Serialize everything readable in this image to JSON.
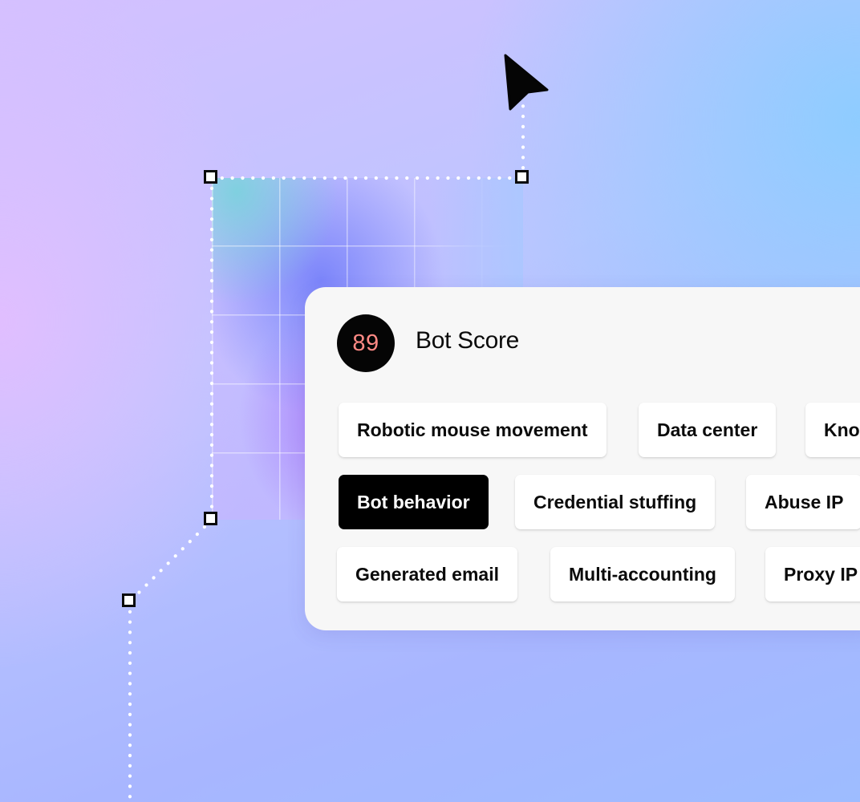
{
  "bot_score": {
    "score": "89",
    "title": "Bot Score",
    "score_color": "#ff8a85"
  },
  "signals": {
    "row1": [
      "Robotic mouse movement",
      "Data center",
      "Kno"
    ],
    "row2": [
      "Bot behavior",
      "Credential stuffing",
      "Abuse IP"
    ],
    "row3": [
      "Generated email",
      "Multi-accounting",
      "Proxy IP"
    ],
    "active": "Bot behavior"
  },
  "icons": {
    "pointer": "cursor-arrow-icon",
    "handles": "selection-handle-icon"
  },
  "colors": {
    "active_tag_bg": "#000000",
    "tag_bg": "#ffffff",
    "card_bg": "#f7f7f7",
    "badge_bg": "#050505"
  }
}
